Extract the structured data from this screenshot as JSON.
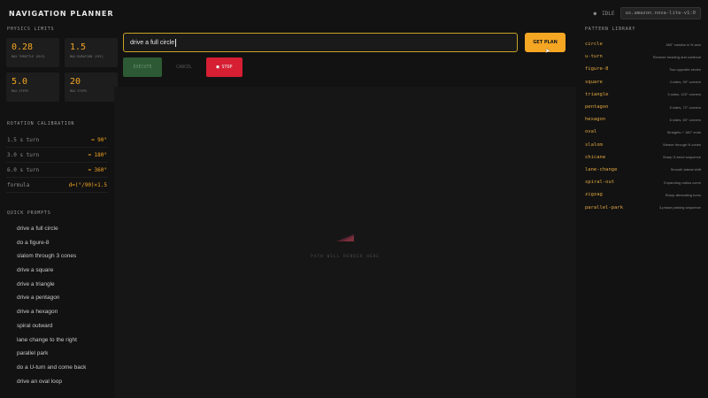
{
  "app": {
    "title": "NAVIGATION PLANNER",
    "status": "IDLE",
    "model": "us.amazon.nova-lite-v1:0"
  },
  "physics": {
    "title": "PHYSICS LIMITS",
    "limits": [
      {
        "value": "0.28",
        "label": "MAX THROTTLE (M/S)"
      },
      {
        "value": "1.5",
        "label": "MAX DURATION (SEC)"
      },
      {
        "value": "5.0",
        "label": "MAX STEPS"
      },
      {
        "value": "20",
        "label": "MAX STEPS"
      }
    ]
  },
  "calibration": {
    "title": "ROTATION CALIBRATION",
    "rows": [
      {
        "k": "1.5 s turn",
        "v": "≈ 90°"
      },
      {
        "k": "3.0 s turn",
        "v": "≈ 180°"
      },
      {
        "k": "6.0 s turn",
        "v": "≈ 360°"
      },
      {
        "k": "formula",
        "v": "d=(°/90)×1.5"
      }
    ]
  },
  "quick_prompts": {
    "title": "QUICK PROMPTS",
    "items": [
      "drive a full circle",
      "do a figure-8",
      "slalom through 3 cones",
      "drive a square",
      "drive a triangle",
      "drive a pentagon",
      "drive a hexagon",
      "spiral outward",
      "lane change to the right",
      "parallel park",
      "do a U-turn and come back",
      "drive an oval loop"
    ]
  },
  "planner": {
    "input_value": "drive a full circle",
    "get_plan_label": "GET PLAN",
    "execute_label": "EXECUTE",
    "cancel_label": "CANCEL",
    "stop_label": "■ STOP",
    "canvas_status": "PATH WILL RENDER HERE"
  },
  "patterns": {
    "title": "PATTERN LIBRARY",
    "items": [
      {
        "name": "circle",
        "desc": "360° rotation in N arcs"
      },
      {
        "name": "u-turn",
        "desc": "Reverse heading and continue"
      },
      {
        "name": "figure-8",
        "desc": "Two opposite circles"
      },
      {
        "name": "square",
        "desc": "4 sides, 90° corners"
      },
      {
        "name": "triangle",
        "desc": "3 sides, 120° corners"
      },
      {
        "name": "pentagon",
        "desc": "5 sides, 72° corners"
      },
      {
        "name": "hexagon",
        "desc": "6 sides, 60° corners"
      },
      {
        "name": "oval",
        "desc": "Straights + 180° ends"
      },
      {
        "name": "slalom",
        "desc": "Weave through N cones"
      },
      {
        "name": "chicane",
        "desc": "Sharp S-bend sequence"
      },
      {
        "name": "lane-change",
        "desc": "Smooth lateral shift"
      },
      {
        "name": "spiral-out",
        "desc": "Expanding radius curve"
      },
      {
        "name": "zigzag",
        "desc": "Sharp alternating turns"
      },
      {
        "name": "parallel-park",
        "desc": "3-phase parking sequence"
      }
    ]
  },
  "colors": {
    "accent": "#f5a623",
    "stop": "#d61f33",
    "execute": "#2d5a34",
    "background": "#121212"
  }
}
